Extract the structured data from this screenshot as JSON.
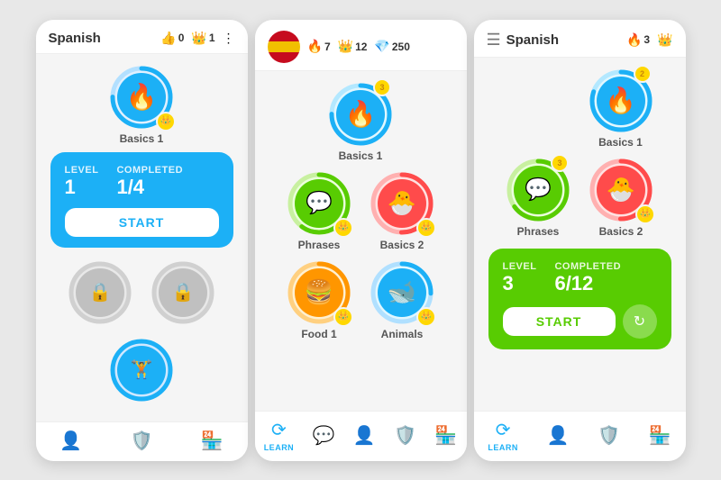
{
  "screens": [
    {
      "id": "screen1",
      "header": {
        "title": "Spanish",
        "showMenu": false,
        "showFlag": false,
        "stats": [
          {
            "type": "heart",
            "value": "0",
            "icon": "👍"
          },
          {
            "type": "crown",
            "value": "1",
            "icon": "👑"
          }
        ],
        "moreIcon": "⋮"
      },
      "lessons": [
        {
          "id": "basics1",
          "label": "Basics 1",
          "color": "#1cb0f6",
          "ringColor": "#ffd700",
          "icon": "🔥",
          "iconBg": "#1cb0f6",
          "badge": "1",
          "locked": false,
          "active": true
        }
      ],
      "infoCard": {
        "type": "blue",
        "level": "1",
        "levelLabel": "Level",
        "completed": "1/4",
        "completedLabel": "Completed",
        "startLabel": "START"
      },
      "lockedItems": 2,
      "bottomNav": [
        {
          "icon": "👤",
          "label": ""
        },
        {
          "icon": "🛡️",
          "label": ""
        },
        {
          "icon": "🏪",
          "label": ""
        }
      ],
      "dumbbell": "🏋️"
    },
    {
      "id": "screen2",
      "header": {
        "showFlag": true,
        "flagColors": [
          "red",
          "yellow"
        ],
        "stats": [
          {
            "type": "fire",
            "value": "7",
            "icon": "🔥"
          },
          {
            "type": "crown",
            "value": "12",
            "icon": "👑"
          },
          {
            "type": "gem",
            "value": "250",
            "icon": "💎"
          }
        ]
      },
      "lessons": [
        {
          "id": "basics1",
          "label": "Basics 1",
          "color": "#1cb0f6",
          "ringComplete": 0.75,
          "icon": "🔥",
          "iconBg": "#1cb0f6",
          "badge": "3",
          "locked": false,
          "single": true
        },
        {
          "id": "phrases",
          "label": "Phrases",
          "color": "#58cc02",
          "icon": "💬",
          "iconBg": "#58cc02",
          "badge": "1",
          "locked": false
        },
        {
          "id": "basics2",
          "label": "Basics 2",
          "color": "#ff4b4b",
          "icon": "🐣",
          "iconBg": "#ff4b4b",
          "badge": "1",
          "locked": false
        },
        {
          "id": "food1",
          "label": "Food 1",
          "color": "#ff9600",
          "icon": "🍔",
          "iconBg": "#ff9600",
          "badge": "1",
          "locked": false
        },
        {
          "id": "animals",
          "label": "Animals",
          "color": "#1cb0f6",
          "icon": "🐋",
          "iconBg": "#1cb0f6",
          "badge": "1",
          "locked": false
        }
      ],
      "bottomNav": [
        {
          "icon": "🔄",
          "label": "LEARN",
          "active": true
        },
        {
          "icon": "💬",
          "label": ""
        },
        {
          "icon": "👤",
          "label": ""
        },
        {
          "icon": "🛡️",
          "label": ""
        },
        {
          "icon": "🏪",
          "label": ""
        }
      ]
    },
    {
      "id": "screen3",
      "header": {
        "title": "Spanish",
        "showMenu": true,
        "showFlag": false,
        "stats": [
          {
            "type": "fire",
            "value": "3",
            "icon": "🔥"
          },
          {
            "type": "crown",
            "value": "",
            "icon": "👑"
          }
        ]
      },
      "lessons": [
        {
          "id": "basics1",
          "label": "Basics 1",
          "color": "#1cb0f6",
          "icon": "🔥",
          "iconBg": "#1cb0f6",
          "badge": "2",
          "locked": false,
          "single": true,
          "alignRight": true
        },
        {
          "id": "phrases",
          "label": "Phrases",
          "color": "#58cc02",
          "icon": "💬",
          "iconBg": "#58cc02",
          "badge": "3",
          "locked": false
        },
        {
          "id": "basics2",
          "label": "Basics 2",
          "color": "#ff4b4b",
          "icon": "🐣",
          "iconBg": "#ff4b4b",
          "badge": "1",
          "locked": false
        }
      ],
      "infoCard": {
        "type": "green",
        "level": "3",
        "levelLabel": "Level",
        "completed": "6/12",
        "completedLabel": "Completed",
        "startLabel": "START"
      },
      "bottomNav": [
        {
          "icon": "🔄",
          "label": "Learn",
          "active": true
        },
        {
          "icon": "👤",
          "label": ""
        },
        {
          "icon": "🛡️",
          "label": ""
        },
        {
          "icon": "🏪",
          "label": ""
        }
      ]
    }
  ]
}
